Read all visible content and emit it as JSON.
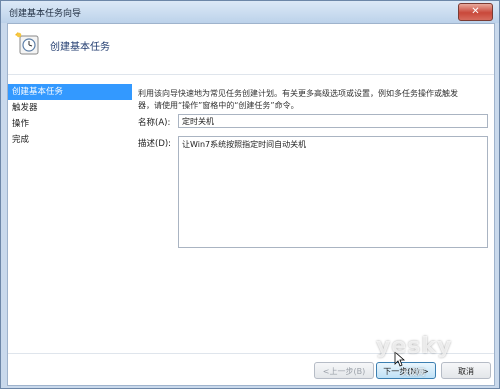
{
  "window": {
    "title": "创建基本任务向导",
    "close_label": "✕"
  },
  "header": {
    "title": "创建基本任务",
    "icon": "task-scheduler-wizard-icon"
  },
  "steps": [
    {
      "label": "创建基本任务",
      "active": true
    },
    {
      "label": "触发器",
      "active": false
    },
    {
      "label": "操作",
      "active": false
    },
    {
      "label": "完成",
      "active": false
    }
  ],
  "main": {
    "description_line1": "利用该向导快速地为常见任务创建计划。有关更多高级选项或设置，例如多任务操作或触发",
    "description_line2": "器，请使用“操作”窗格中的“创建任务”命令。",
    "name_label": "名称(A):",
    "name_value": "定时关机",
    "desc_label": "描述(D):",
    "desc_value": "让Win7系统按照指定时间自动关机"
  },
  "footer": {
    "back_label": "<上一步(B)",
    "next_label": "下一步(N) >",
    "cancel_label": "取消"
  },
  "watermark": {
    "brand": "yesky",
    "sub": "天极网"
  },
  "colors": {
    "selection": "#3399ff",
    "title_text": "#1f3a6e"
  }
}
